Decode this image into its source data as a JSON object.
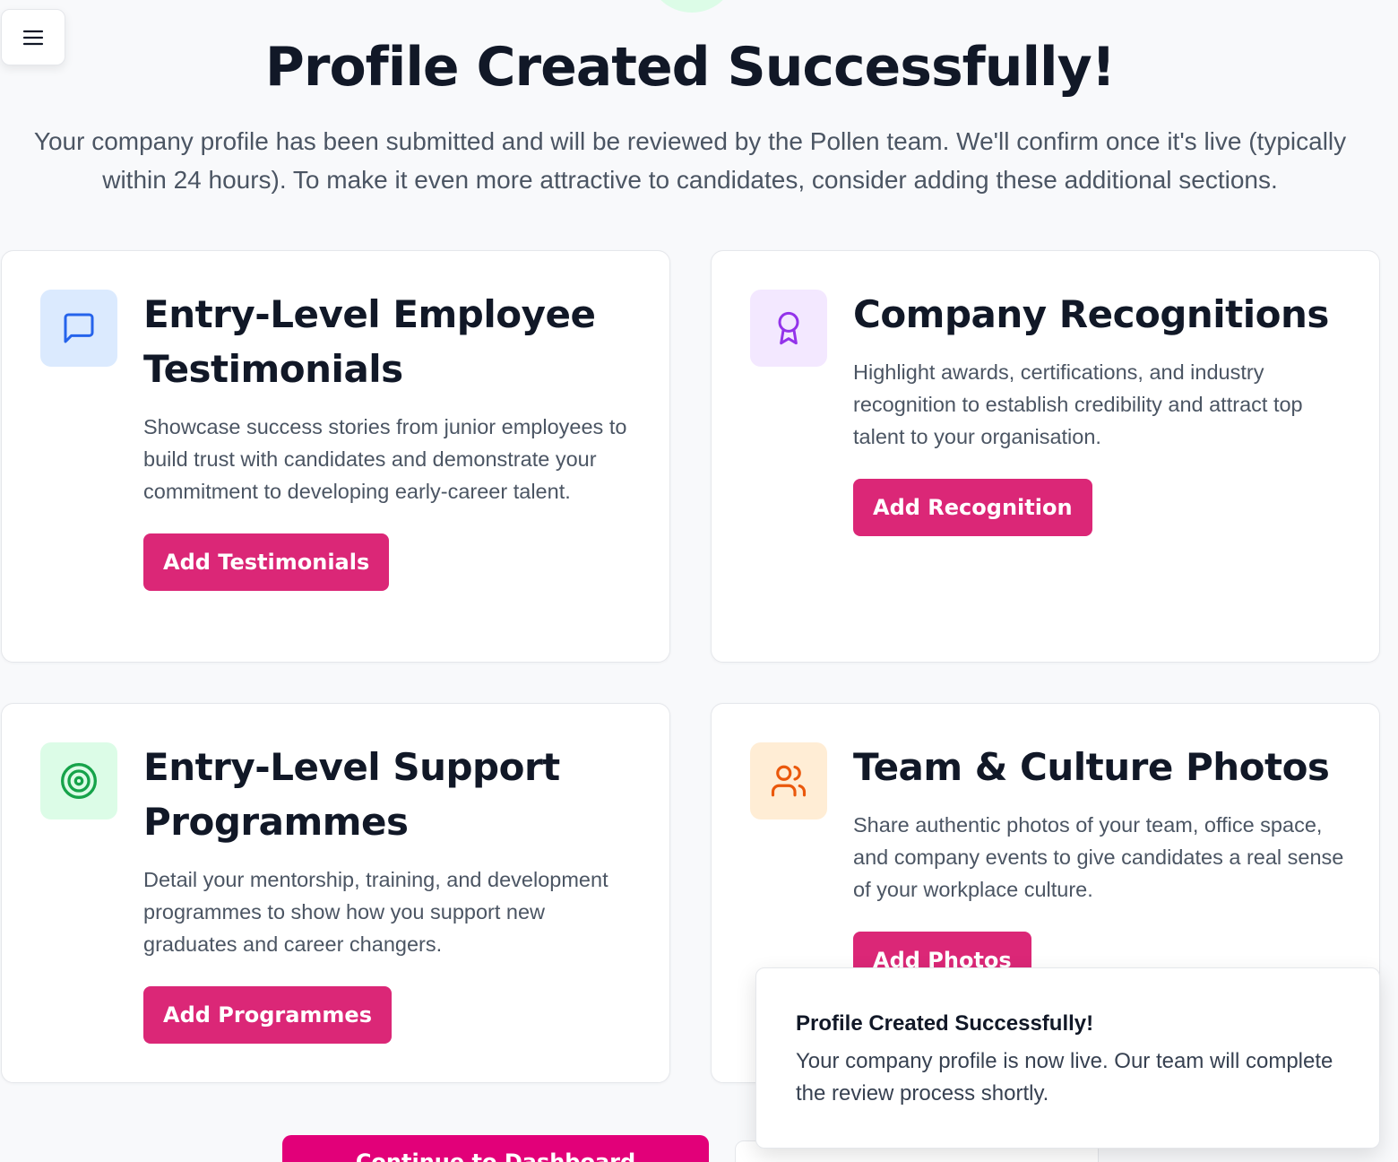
{
  "header": {
    "title": "Profile Created Successfully!",
    "subtitle": "Your company profile has been submitted and will be reviewed by the Pollen team. We'll confirm once it's live (typically within 24 hours). To make it even more attractive to candidates, consider adding these additional sections."
  },
  "menu": {
    "icon": "hamburger-menu-icon"
  },
  "cards": [
    {
      "title": "Entry-Level Employee Testimonials",
      "description": "Showcase success stories from junior employees to build trust with candidates and demonstrate your commitment to developing early-career talent.",
      "button": "Add Testimonials",
      "icon": "message-square-icon",
      "icon_bg": "#dbeafe",
      "icon_color": "#2563eb"
    },
    {
      "title": "Company Recognitions",
      "description": "Highlight awards, certifications, and industry recognition to establish credibility and attract top talent to your organisation.",
      "button": "Add Recognition",
      "icon": "award-icon",
      "icon_bg": "#f3e8ff",
      "icon_color": "#9333ea"
    },
    {
      "title": "Entry-Level Support Programmes",
      "description": "Detail your mentorship, training, and development programmes to show how you support new graduates and career changers.",
      "button": "Add Programmes",
      "icon": "target-icon",
      "icon_bg": "#dcfce7",
      "icon_color": "#16a34a"
    },
    {
      "title": "Team & Culture Photos",
      "description": "Share authentic photos of your team, office space, and company events to give candidates a real sense of your workplace culture.",
      "button": "Add Photos",
      "icon": "users-icon",
      "icon_bg": "#ffedd5",
      "icon_color": "#ea580c"
    }
  ],
  "actions": {
    "continue_label": "Continue to Dashboard"
  },
  "toast": {
    "title": "Profile Created Successfully!",
    "message": "Your company profile is now live. Our team will complete the review process shortly."
  },
  "colors": {
    "accent": "#db2777",
    "continue": "#e20079",
    "background": "#f8f9fb"
  }
}
